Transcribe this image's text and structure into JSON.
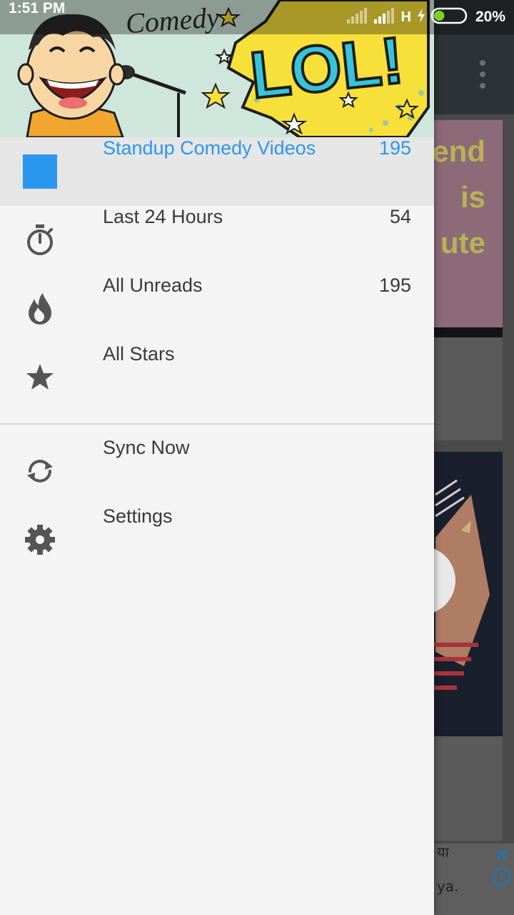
{
  "status_bar": {
    "time": "1:51 PM",
    "network_type": "H",
    "battery_percent": "20%",
    "battery_level": 0.2
  },
  "header": {
    "banner_text_comedy": "Comedy",
    "banner_text_lol": "LOL!"
  },
  "drawer": {
    "items": [
      {
        "label": "Standup Comedy Videos",
        "count": "195",
        "icon": "feed-square-icon",
        "active": true
      },
      {
        "label": "Last 24 Hours",
        "count": "54",
        "icon": "stopwatch-icon",
        "active": false
      },
      {
        "label": "All Unreads",
        "count": "195",
        "icon": "flame-icon",
        "active": false
      },
      {
        "label": "All Stars",
        "count": "",
        "icon": "star-icon",
        "active": false
      }
    ],
    "actions": [
      {
        "label": "Sync Now",
        "icon": "sync-icon"
      },
      {
        "label": "Settings",
        "icon": "gear-icon"
      }
    ]
  },
  "background": {
    "card_text_lines": [
      "end",
      "is",
      "ute"
    ],
    "ad_text_line1": "या",
    "ad_text_line2": "ya.",
    "ad_close": "✕",
    "ad_info": "i"
  },
  "colors": {
    "accent": "#2b96ee",
    "text": "#3a3a3a",
    "drawer_bg": "#f4f4f4",
    "active_bg": "#e6e6e6"
  }
}
